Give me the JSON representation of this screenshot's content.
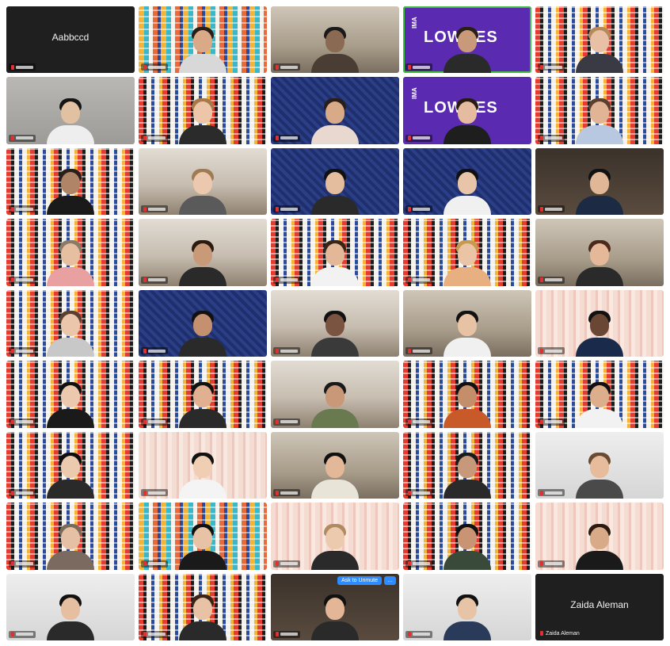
{
  "placeholder_tiles": {
    "top_left_name": "Aabbccd",
    "bottom_right_name": "Zaida Aleman",
    "bottom_right_label": "Zaida Aleman"
  },
  "brand": {
    "ima_text": "IMA",
    "logo_text": "LOWRES"
  },
  "tile_actions": {
    "ask_to_unmute_label": "Ask to Unmute",
    "more_label": "…"
  },
  "colors": {
    "speaking_border": "#3fbf3f",
    "unmute_button": "#2d8cff",
    "mic_muted": "#e03030"
  }
}
